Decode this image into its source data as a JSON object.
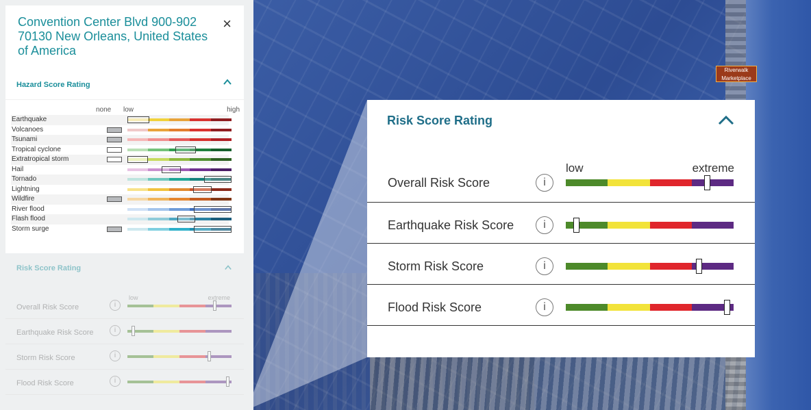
{
  "map": {
    "marker_label": "Riverwalk Marketplace"
  },
  "sidebar": {
    "address": "Convention Center Blvd 900-902 70130 New Orleans, United States of America",
    "close_label": "×",
    "hazard": {
      "title": "Hazard Score Rating",
      "legend": {
        "none": "none",
        "low": "low",
        "high": "high"
      },
      "rows": [
        {
          "label": "Earthquake",
          "none": false,
          "colors": [
            "#f4e6a0",
            "#f1d23b",
            "#e8a33a",
            "#d8322f",
            "#8f1d20"
          ],
          "mark": [
            0,
            0.21
          ]
        },
        {
          "label": "Volcanoes",
          "none": true,
          "colors": [
            "#f0c9c9",
            "#e8a33a",
            "#e27d2e",
            "#d8322f",
            "#8f1d20"
          ],
          "mark": null
        },
        {
          "label": "Tsunami",
          "none": true,
          "colors": [
            "#f6b7b7",
            "#f18f8f",
            "#e55b5b",
            "#d8322f",
            "#b01f24"
          ],
          "mark": null
        },
        {
          "label": "Tropical cyclone",
          "none": false,
          "colors": [
            "#b9e0b5",
            "#73c27a",
            "#2f9e4f",
            "#1e7f3d",
            "#155f2c"
          ],
          "mark": [
            0.46,
            0.2
          ]
        },
        {
          "label": "Extratropical storm",
          "none": false,
          "colors": [
            "#e6f0a9",
            "#c7db5e",
            "#8fb93e",
            "#4f8f2f",
            "#2c6021"
          ],
          "mark": [
            0,
            0.2
          ]
        },
        {
          "label": "Hail",
          "none": false,
          "colors": [
            "#e8c4e4",
            "#c98fcf",
            "#9d59b3",
            "#6f2f8f",
            "#4b1d66"
          ],
          "mark": [
            0.33,
            0.18
          ]
        },
        {
          "label": "Tornado",
          "none": false,
          "colors": [
            "#bfe5df",
            "#6ec7bd",
            "#1fa596",
            "#15807b",
            "#0c5d5d"
          ],
          "mark": [
            0.74,
            0.26
          ]
        },
        {
          "label": "Lightning",
          "none": false,
          "colors": [
            "#f8e28a",
            "#f1c23e",
            "#e08a30",
            "#c8512a",
            "#8b2a1b"
          ],
          "mark": [
            0.63,
            0.18
          ]
        },
        {
          "label": "Wildfire",
          "none": true,
          "colors": [
            "#f6d7a3",
            "#f0b45a",
            "#e5852d",
            "#c45a1e",
            "#7f3413"
          ],
          "mark": null
        },
        {
          "label": "River flood",
          "none": false,
          "colors": [
            "#cfe1f6",
            "#a3c4ec",
            "#6e9cd9",
            "#3f6fbf",
            "#2a4b8f"
          ],
          "mark": [
            0.64,
            0.36
          ]
        },
        {
          "label": "Flash flood",
          "none": false,
          "colors": [
            "#cde8ef",
            "#8fcbd9",
            "#4fa8c2",
            "#2a82a3",
            "#1a5c7b"
          ],
          "mark": [
            0.48,
            0.17
          ]
        },
        {
          "label": "Storm surge",
          "none": true,
          "colors": [
            "#cde8ef",
            "#7fcfe0",
            "#2fb0ca",
            "#1f8fb0",
            "#155f7f"
          ],
          "mark": [
            0.64,
            0.36
          ]
        }
      ]
    },
    "risk": {
      "title": "Risk Score Rating",
      "low": "low",
      "extreme": "extreme",
      "rows": [
        {
          "label": "Overall Risk Score",
          "level": 0.84
        },
        {
          "label": "Earthquake Risk Score",
          "level": 0.06
        },
        {
          "label": "Storm Risk Score",
          "level": 0.79
        },
        {
          "label": "Flood Risk Score",
          "level": 0.97
        }
      ]
    }
  },
  "popup": {
    "title": "Risk Score Rating",
    "low": "low",
    "extreme": "extreme",
    "info_glyph": "i",
    "colors": [
      "#4d8a2a",
      "#f2e33a",
      "#e0262c",
      "#5d2a83"
    ],
    "rows": [
      {
        "label": "Overall Risk Score",
        "level": 0.84
      },
      {
        "label": "Earthquake Risk Score",
        "level": 0.06
      },
      {
        "label": "Storm Risk Score",
        "level": 0.79
      },
      {
        "label": "Flood Risk Score",
        "level": 0.96
      }
    ]
  }
}
